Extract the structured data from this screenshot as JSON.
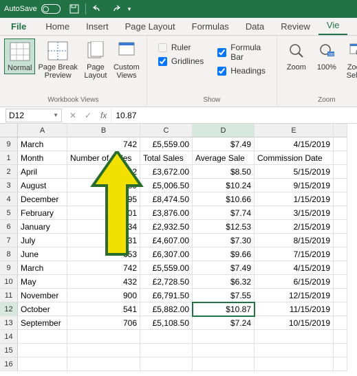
{
  "titlebar": {
    "autosave": "AutoSave"
  },
  "tabs": {
    "file": "File",
    "home": "Home",
    "insert": "Insert",
    "pagelayout": "Page Layout",
    "formulas": "Formulas",
    "data": "Data",
    "review": "Review",
    "view": "Vie"
  },
  "ribbon": {
    "views": {
      "normal": "Normal",
      "pagebreak": "Page Break\nPreview",
      "pagelayout": "Page\nLayout",
      "custom": "Custom\nViews",
      "label": "Workbook Views"
    },
    "show": {
      "ruler": "Ruler",
      "formulabar": "Formula Bar",
      "gridlines": "Gridlines",
      "headings": "Headings",
      "label": "Show"
    },
    "zoom": {
      "zoom": "Zoom",
      "pct": "100%",
      "selection": "Zoom\nSelect",
      "label": "Zoom"
    }
  },
  "formula": {
    "cellref": "D12",
    "fx": "fx",
    "value": "10.87"
  },
  "colheads": [
    "A",
    "B",
    "C",
    "D",
    "E"
  ],
  "rows": [
    {
      "n": "9",
      "a": "March",
      "b": "742",
      "c": "£5,559.00",
      "d": "$7.49",
      "e": "4/15/2019"
    },
    {
      "n": "1",
      "a": "Month",
      "b": "Number of Sales",
      "c": "Total Sales",
      "d": "Average Sale",
      "e": "Commission Date"
    },
    {
      "n": "2",
      "a": "April",
      "b": "432",
      "c": "£3,672.00",
      "d": "$8.50",
      "e": "5/15/2019"
    },
    {
      "n": "3",
      "a": "August",
      "b": "489",
      "c": "£5,006.50",
      "d": "$10.24",
      "e": "9/15/2019"
    },
    {
      "n": "4",
      "a": "December",
      "b": "795",
      "c": "£8,474.50",
      "d": "$10.66",
      "e": "1/15/2019"
    },
    {
      "n": "5",
      "a": "February",
      "b": "501",
      "c": "£3,876.00",
      "d": "$7.74",
      "e": "3/15/2019"
    },
    {
      "n": "6",
      "a": "January",
      "b": "234",
      "c": "£2,932.50",
      "d": "$12.53",
      "e": "2/15/2019"
    },
    {
      "n": "7",
      "a": "July",
      "b": "631",
      "c": "£4,607.00",
      "d": "$7.30",
      "e": "8/15/2019"
    },
    {
      "n": "8",
      "a": "June",
      "b": "653",
      "c": "£6,307.00",
      "d": "$9.66",
      "e": "7/15/2019"
    },
    {
      "n": "9",
      "a": "March",
      "b": "742",
      "c": "£5,559.00",
      "d": "$7.49",
      "e": "4/15/2019"
    },
    {
      "n": "10",
      "a": "May",
      "b": "432",
      "c": "£2,728.50",
      "d": "$6.32",
      "e": "6/15/2019"
    },
    {
      "n": "11",
      "a": "November",
      "b": "900",
      "c": "£6,791.50",
      "d": "$7.55",
      "e": "12/15/2019"
    },
    {
      "n": "12",
      "a": "October",
      "b": "541",
      "c": "£5,882.00",
      "d": "$10.87",
      "e": "11/15/2019"
    },
    {
      "n": "13",
      "a": "September",
      "b": "706",
      "c": "£5,108.50",
      "d": "$7.24",
      "e": "10/15/2019"
    },
    {
      "n": "14",
      "a": "",
      "b": "",
      "c": "",
      "d": "",
      "e": ""
    },
    {
      "n": "15",
      "a": "",
      "b": "",
      "c": "",
      "d": "",
      "e": ""
    },
    {
      "n": "16",
      "a": "",
      "b": "",
      "c": "",
      "d": "",
      "e": ""
    }
  ],
  "selected": {
    "row": 12,
    "col": "D"
  }
}
